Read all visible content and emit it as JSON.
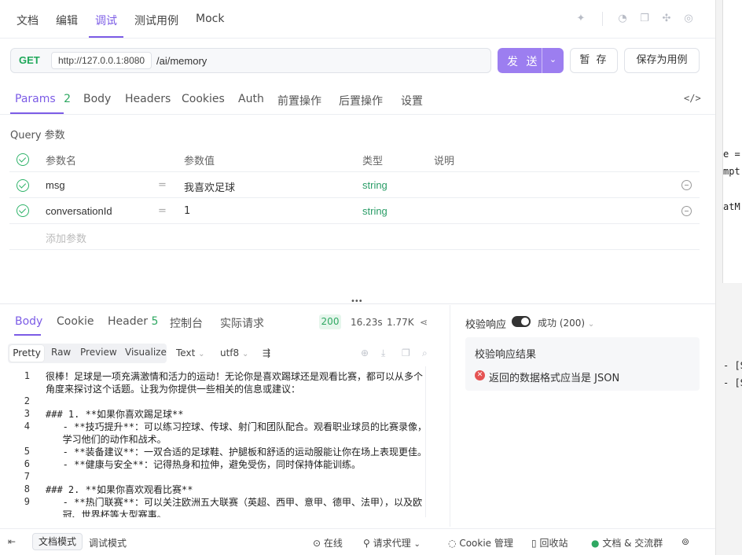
{
  "top_tabs": [
    "文档",
    "编辑",
    "调试",
    "测试用例",
    "Mock"
  ],
  "request": {
    "method": "GET",
    "host": "http://127.0.0.1:8080",
    "path": "/ai/memory",
    "send_label": "发 送",
    "save_label": "暂 存",
    "save_case_label": "保存为用例"
  },
  "req_tabs": {
    "params_label": "Params",
    "params_count": "2",
    "others": [
      "Body",
      "Headers",
      "Cookies",
      "Auth",
      "前置操作",
      "后置操作",
      "设置"
    ]
  },
  "params": {
    "title": "Query 参数",
    "headers": [
      "参数名",
      "参数值",
      "类型",
      "说明"
    ],
    "rows": [
      {
        "name": "msg",
        "eq": "=",
        "value": "我喜欢足球",
        "type": "string"
      },
      {
        "name": "conversationId",
        "eq": "=",
        "value": "1",
        "type": "string"
      }
    ],
    "add_placeholder": "添加参数"
  },
  "response": {
    "tabs": [
      "Body",
      "Cookie",
      "Header",
      "控制台",
      "实际请求"
    ],
    "header_count": "5",
    "status": "200",
    "time": "16.23s",
    "size": "1.77K",
    "formats": [
      "Pretty",
      "Raw",
      "Preview",
      "Visualize"
    ],
    "type_select": "Text",
    "encoding_select": "utf8",
    "code_lines": [
      {
        "n": "1",
        "text": "很棒！足球是一项充满激情和活力的运动！无论你是喜欢踢球还是观看比赛，都可以从多个"
      },
      {
        "n": "",
        "text": "角度来探讨这个话题。让我为你提供一些相关的信息或建议："
      },
      {
        "n": "2",
        "text": ""
      },
      {
        "n": "3",
        "text": "### 1. **如果你喜欢踢足球**"
      },
      {
        "n": "4",
        "text": "   - **技巧提升**：可以练习控球、传球、射门和团队配合。观看职业球员的比赛录像，"
      },
      {
        "n": "",
        "text": "   学习他们的动作和战术。"
      },
      {
        "n": "5",
        "text": "   - **装备建议**：一双合适的足球鞋、护腿板和舒适的运动服能让你在场上表现更佳。"
      },
      {
        "n": "6",
        "text": "   - **健康与安全**：记得热身和拉伸，避免受伤，同时保持体能训练。"
      },
      {
        "n": "7",
        "text": ""
      },
      {
        "n": "8",
        "text": "### 2. **如果你喜欢观看比赛**"
      },
      {
        "n": "9",
        "text": "   - **热门联赛**：可以关注欧洲五大联赛（英超、西甲、意甲、德甲、法甲），以及欧"
      },
      {
        "n": "",
        "text": "   冠、世界杯等大型赛事。"
      }
    ]
  },
  "validate": {
    "label": "校验响应",
    "status": "成功 (200)",
    "box_title": "校验响应结果",
    "error": "返回的数据格式应当是 JSON"
  },
  "bottom": {
    "doc_mode": "文档模式",
    "debug_mode": "调试模式",
    "online": "在线",
    "proxy": "请求代理",
    "cookie": "Cookie 管理",
    "trash": "回收站",
    "docs": "文档 & 交流群"
  },
  "sliver_text": [
    "e = [",
    "mpt",
    "atM",
    "- [S",
    "- [S"
  ],
  "colors": {
    "accent": "#7c5ce6",
    "send": "#9c7ef0",
    "success": "#2fa862",
    "error": "#e55353"
  }
}
